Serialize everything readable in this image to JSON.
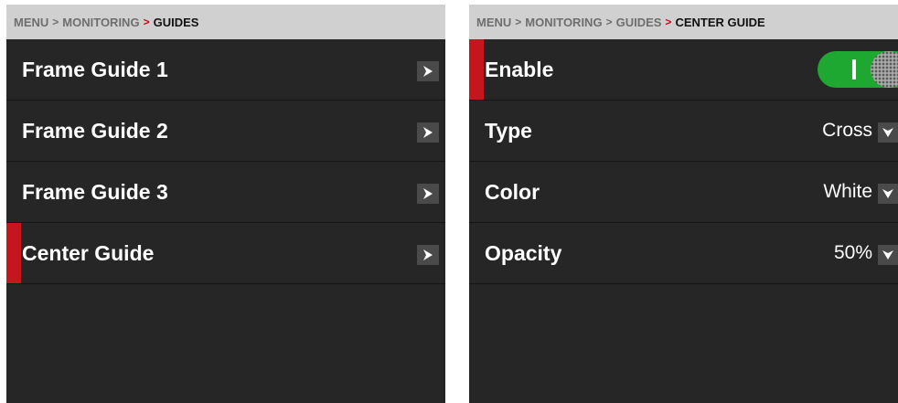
{
  "left_panel": {
    "breadcrumb": {
      "items": [
        "MENU",
        "MONITORING"
      ],
      "separator": ">",
      "current": "GUIDES"
    },
    "rows": [
      {
        "label": "Frame Guide 1"
      },
      {
        "label": "Frame Guide 2"
      },
      {
        "label": "Frame Guide 3"
      },
      {
        "label": "Center Guide"
      }
    ],
    "selected_row": "Center Guide"
  },
  "right_panel": {
    "breadcrumb": {
      "items": [
        "MENU",
        "MONITORING",
        "GUIDES"
      ],
      "separator": ">",
      "current": "CENTER GUIDE"
    },
    "enable": {
      "label": "Enable",
      "state": "on"
    },
    "type": {
      "label": "Type",
      "value": "Cross"
    },
    "color": {
      "label": "Color",
      "value": "White"
    },
    "opacity": {
      "label": "Opacity",
      "value": "50%"
    },
    "selected_row": "Enable"
  },
  "icons": {
    "submenu": "chevron-right-icon",
    "dropdown": "chevron-down-icon"
  },
  "colors": {
    "accent_red": "#c4161c",
    "toggle_on": "#1fa831",
    "background": "#262626",
    "breadcrumb_bg": "#d0d0d0"
  }
}
